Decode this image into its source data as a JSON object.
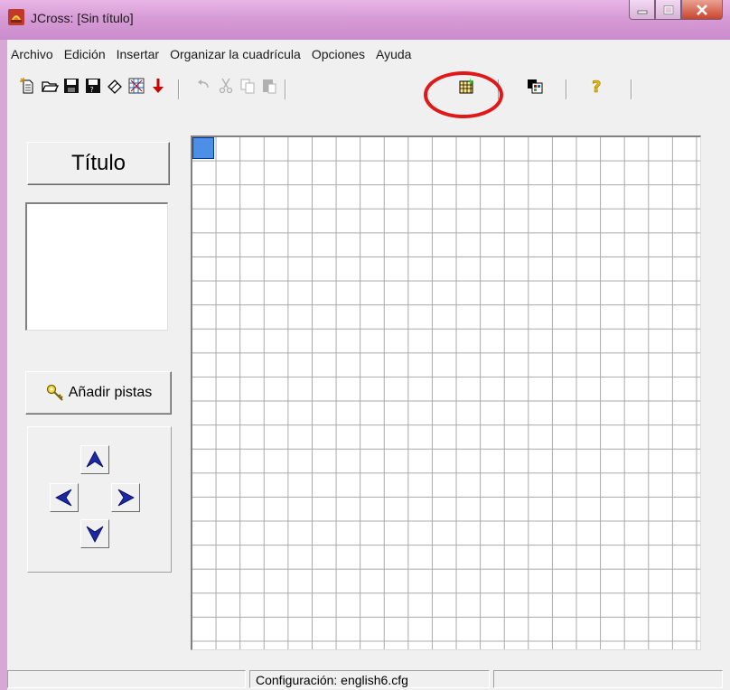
{
  "window": {
    "title": "JCross: [Sin título]",
    "title_color": "#d79bd6"
  },
  "menu": [
    "Archivo",
    "Edición",
    "Insertar",
    "Organizar la cuadrícula",
    "Opciones",
    "Ayuda"
  ],
  "toolbar": {
    "icons": [
      "new-file-icon",
      "open-folder-icon",
      "save-icon",
      "save-as-icon",
      "erase-icon",
      "export-web-icon",
      "down-arrow-icon",
      "undo-icon",
      "cut-icon",
      "copy-icon",
      "paste-icon",
      "grid-automatic-icon",
      "options-icon",
      "help-icon"
    ]
  },
  "left_panel": {
    "title_button": "Título",
    "add_clues_button": "Añadir pistas",
    "arrows": [
      "up",
      "left",
      "right",
      "down"
    ]
  },
  "grid": {
    "columns": 21,
    "rows": 21,
    "selected_cell": [
      0,
      0
    ],
    "cursor_color": "#4d8fe6"
  },
  "statusbar": {
    "config": "Configuración: english6.cfg"
  },
  "annotation": {
    "highlight_color": "#e01818"
  }
}
